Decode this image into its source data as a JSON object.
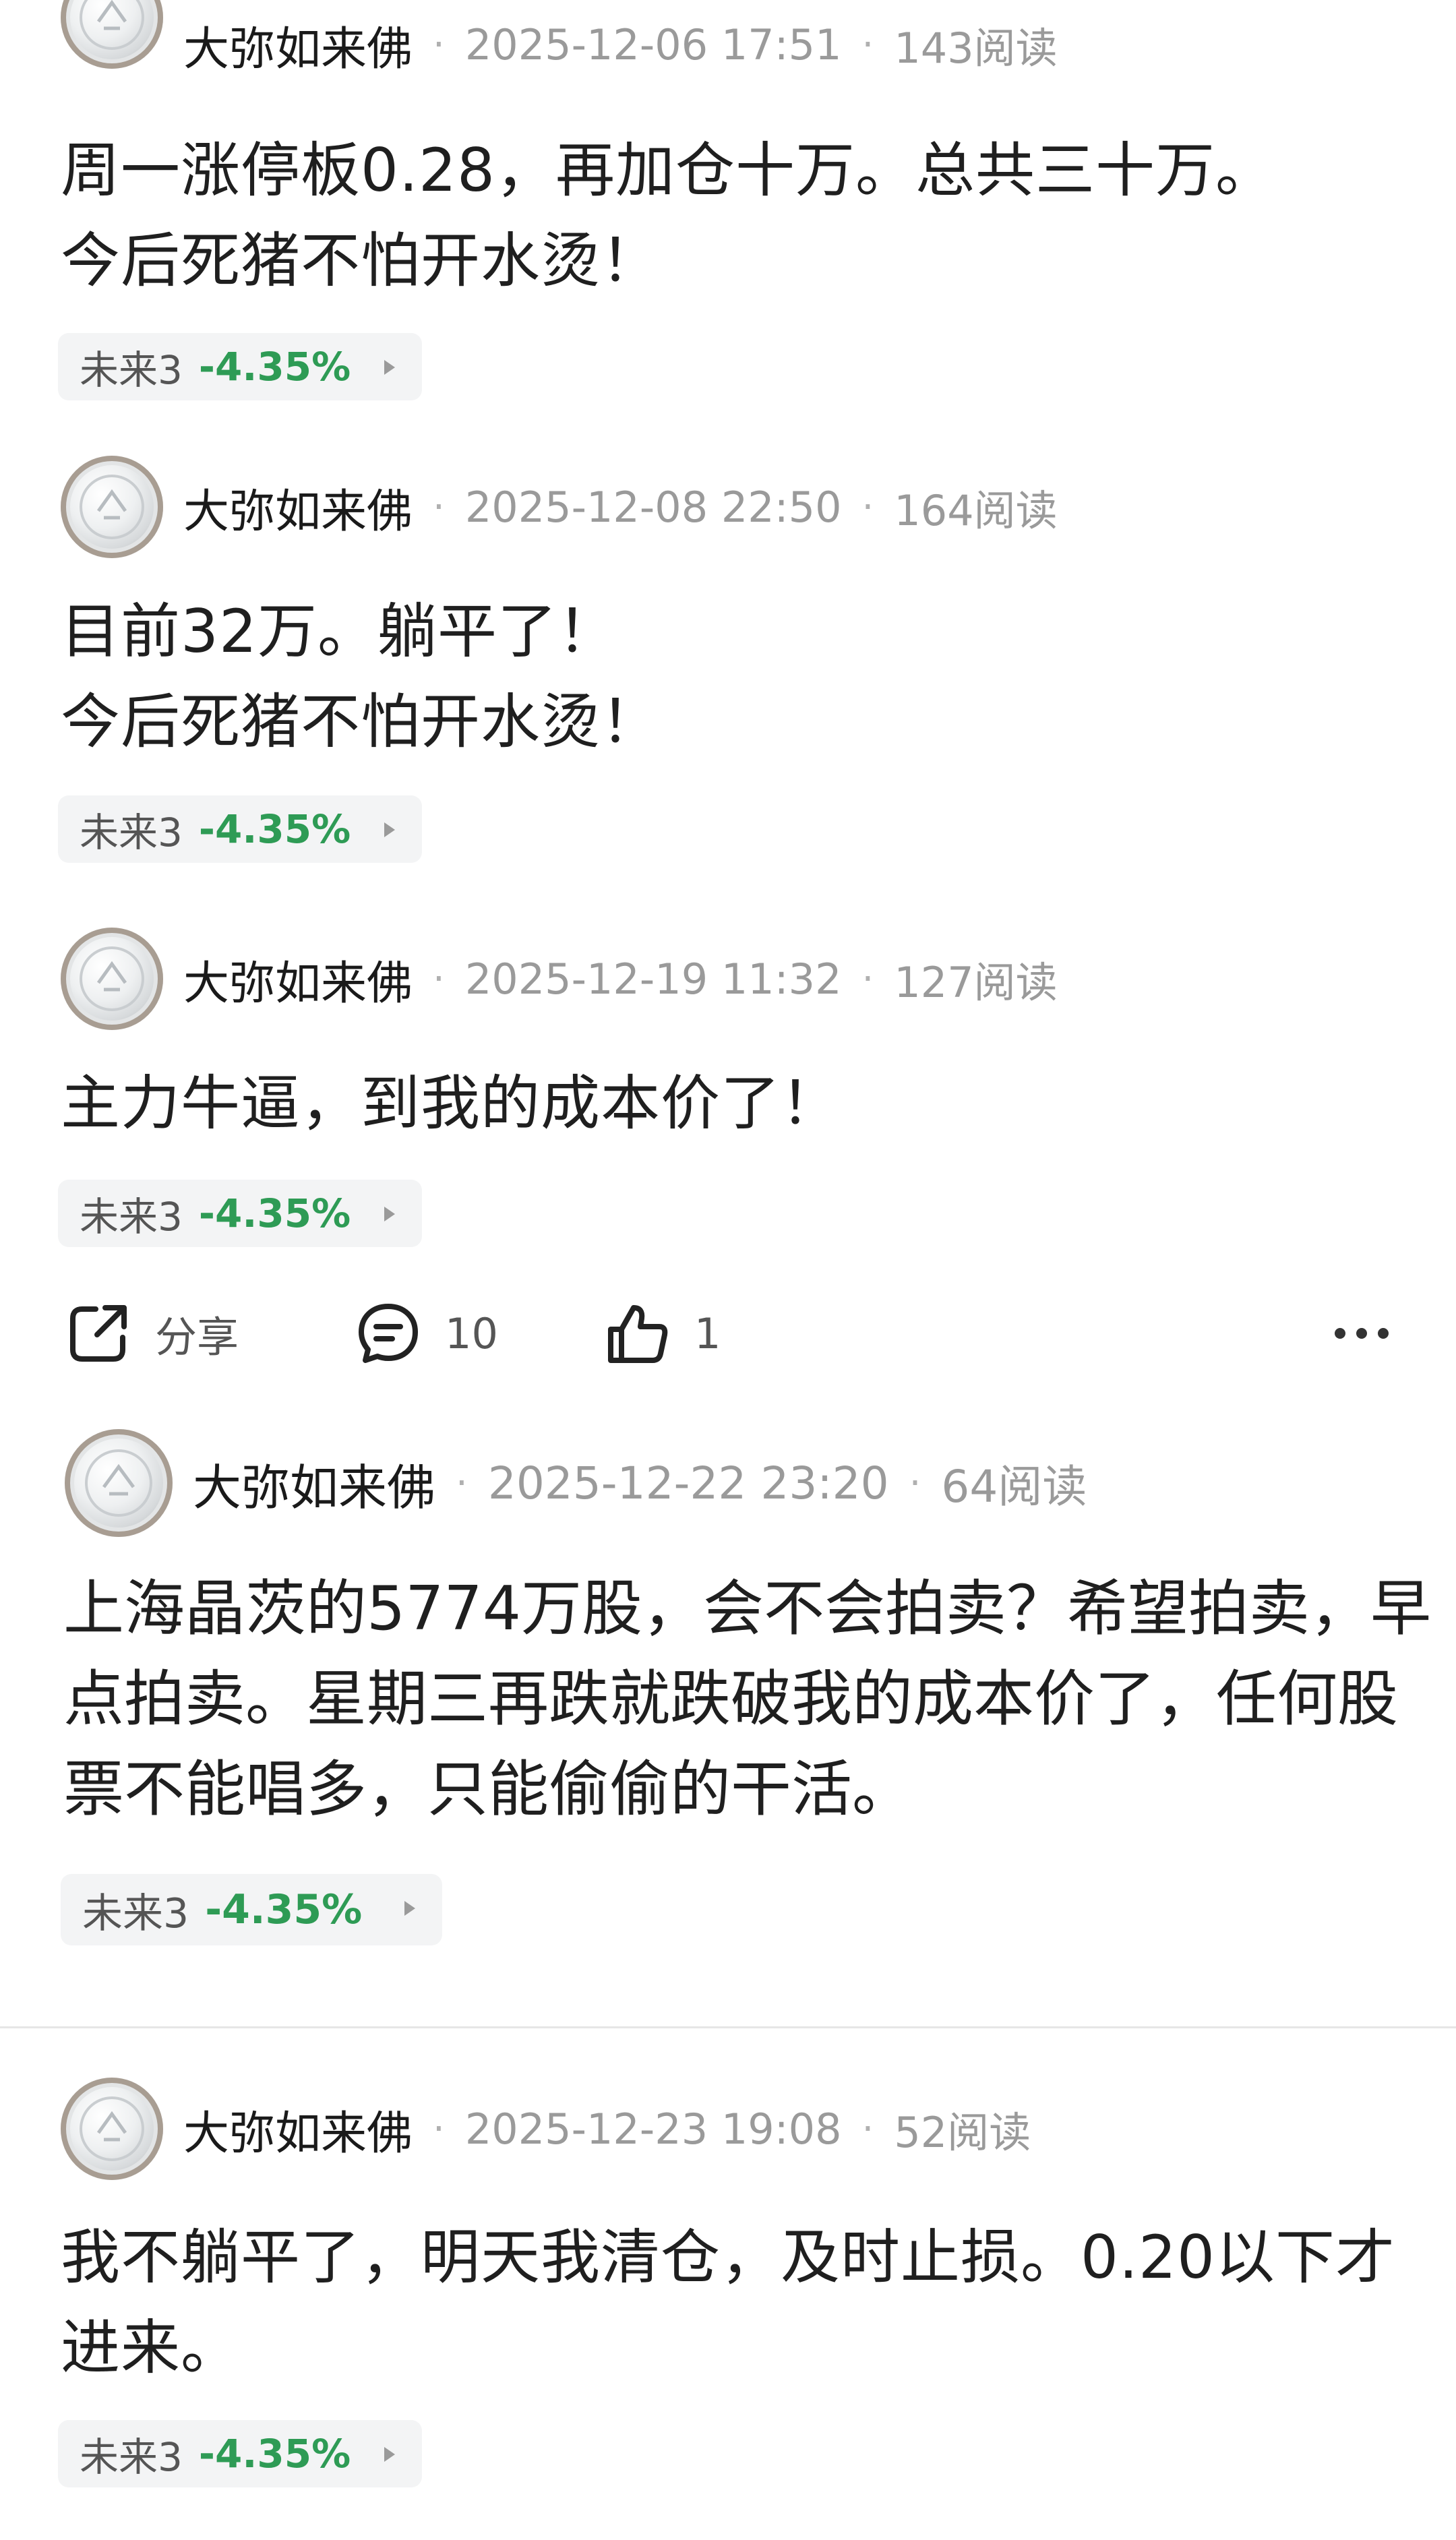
{
  "posts": [
    {
      "author": "大弥如来佛",
      "date": "2025-12-06 17:51",
      "reads": "143阅读",
      "content": "周一涨停板0.28，再加仓十万。总共三十万。\n今后死猪不怕开水烫！",
      "stock": {
        "name": "未来3",
        "change": "-4.35%"
      }
    },
    {
      "author": "大弥如来佛",
      "date": "2025-12-08 22:50",
      "reads": "164阅读",
      "content": "目前32万。躺平了！\n今后死猪不怕开水烫！",
      "stock": {
        "name": "未来3",
        "change": "-4.35%"
      }
    },
    {
      "author": "大弥如来佛",
      "date": "2025-12-19 11:32",
      "reads": "127阅读",
      "content": "主力牛逼，到我的成本价了！",
      "stock": {
        "name": "未来3",
        "change": "-4.35%"
      }
    },
    {
      "author": "大弥如来佛",
      "date": "2025-12-22 23:20",
      "reads": "64阅读",
      "content": "上海晶茨的5774万股，会不会拍卖？希望拍卖，早\n点拍卖。星期三再跌就跌破我的成本价了，任何股\n票不能唱多，只能偷偷的干活。",
      "stock": {
        "name": "未来3",
        "change": "-4.35%"
      }
    },
    {
      "author": "大弥如来佛",
      "date": "2025-12-23 19:08",
      "reads": "52阅读",
      "content": "我不躺平了，明天我清仓，及时止损。0.20以下才\n进来。",
      "stock": {
        "name": "未来3",
        "change": "-4.35%"
      }
    }
  ],
  "actions": {
    "share_label": "分享",
    "comment_count": "10",
    "like_count": "1",
    "icons": {
      "share": "share-icon",
      "comment": "comment-icon",
      "like": "thumbs-up-icon",
      "more": "more-icon"
    }
  },
  "colors": {
    "positive_change": "#2e9b55",
    "muted_text": "#9a9a9a",
    "tag_background": "#f3f4f5"
  }
}
